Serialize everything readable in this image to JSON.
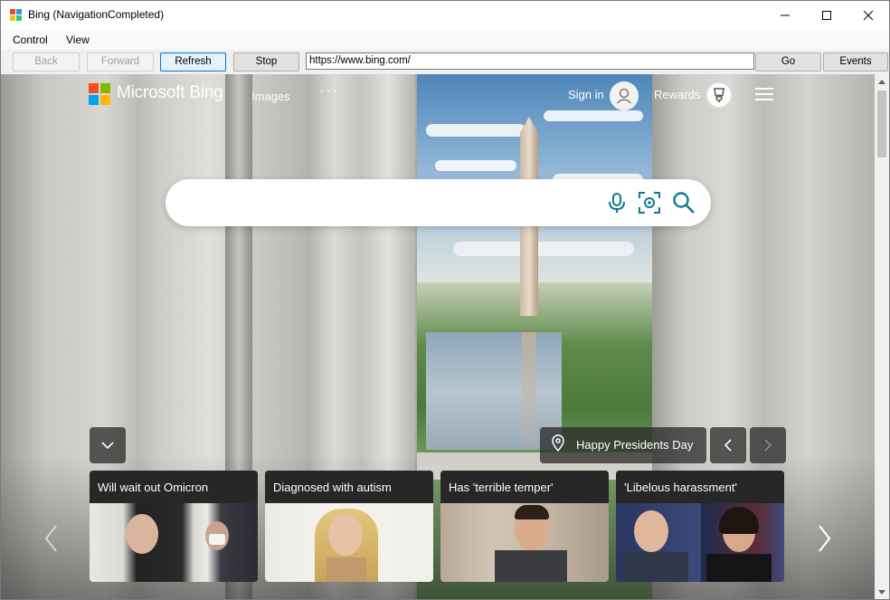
{
  "window": {
    "title": "Bing (NavigationCompleted)"
  },
  "menu": {
    "items": [
      "Control",
      "View"
    ]
  },
  "toolbar": {
    "back_label": "Back",
    "forward_label": "Forward",
    "refresh_label": "Refresh",
    "stop_label": "Stop",
    "go_label": "Go",
    "events_label": "Events",
    "address_value": "https://www.bing.com/"
  },
  "bing": {
    "brand": "Microsoft Bing",
    "nav_images": "Images",
    "nav_more": "···",
    "sign_in": "Sign in",
    "rewards": "Rewards",
    "search_placeholder": "",
    "location_label": "Happy Presidents Day",
    "news": [
      {
        "title": "Will wait out Omicron"
      },
      {
        "title": "Diagnosed with autism"
      },
      {
        "title": "Has 'terrible temper'"
      },
      {
        "title": "'Libelous harassment'"
      }
    ]
  },
  "colors": {
    "accent": "#0078d4",
    "ms_red": "#f25022",
    "ms_green": "#7fba00",
    "ms_blue": "#00a4ef",
    "ms_yellow": "#ffb900",
    "bing_teal": "#174ae4"
  }
}
